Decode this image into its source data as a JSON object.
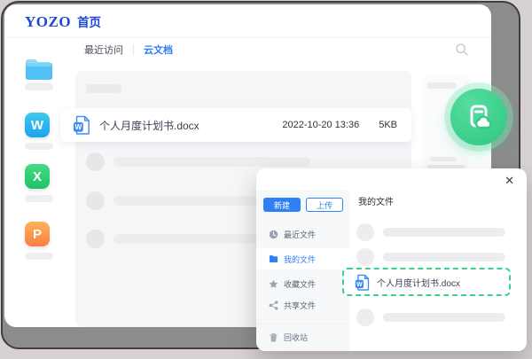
{
  "header": {
    "logo": "YOZO",
    "page_title": "首页"
  },
  "tabs": {
    "recent_label": "最近访问",
    "cloud_label": "云文档"
  },
  "dock": {
    "writer_letter": "W",
    "sheet_letter": "X",
    "presentation_letter": "P"
  },
  "icons": {
    "doc_letter": "W"
  },
  "file_row": {
    "name": "个人月度计划书.docx",
    "modified": "2022-10-20 13:36",
    "size": "5KB"
  },
  "modal": {
    "close_glyph": "✕",
    "new_button_label": "新建",
    "upload_button_label": "上传",
    "section_title": "我的文件",
    "menu": [
      {
        "label": "最近文件",
        "icon": "clock-icon"
      },
      {
        "label": "我的文件",
        "icon": "folder-icon",
        "active": true
      },
      {
        "label": "收藏文件",
        "icon": "star-icon"
      },
      {
        "label": "共享文件",
        "icon": "share-icon"
      }
    ],
    "trash_label": "回收站",
    "highlighted_file": {
      "name": "个人月度计划书.docx"
    }
  },
  "colors": {
    "accent_blue": "#2f80f7",
    "logo_blue": "#1b49d3",
    "brand_green": "#3ecf8e",
    "writer_blue": "#1da2f2",
    "sheet_green": "#22c768",
    "presentation_orange": "#f97e43"
  }
}
